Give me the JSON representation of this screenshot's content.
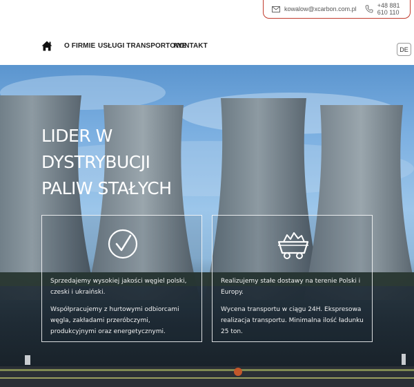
{
  "contact": {
    "email": "kowalow@xcarbon.com.pl",
    "phone": "+48 881 610 110"
  },
  "nav": {
    "items": [
      "O FIRMIE",
      "USŁUGI TRANSPORTOWE",
      "KONTAKT"
    ],
    "language": "DE"
  },
  "hero": {
    "title_lines": [
      "LIDER W",
      "DYSTRYBUCJI",
      "PALIW STAŁYCH"
    ]
  },
  "cards": [
    {
      "icon": "checkmark-circle-icon",
      "paragraphs": [
        "Sprzedajemy wysokiej jakości węgiel polski, czeski i ukraiński.",
        "Współpracujemy z hurtowymi odbiorcami węgla, zakładami przeróbczymi, produkcyjnymi oraz energetycznymi."
      ]
    },
    {
      "icon": "coal-cart-icon",
      "paragraphs": [
        "Realizujemy stałe dostawy na terenie Polski i Europy.",
        "Wycena transportu w ciągu 24H. Ekspresowa realizacja transportu. Minimalna ilość ładunku 25 ton."
      ]
    }
  ],
  "colors": {
    "accent": "#c0392b",
    "text_dark": "#222222",
    "hero_text": "#ffffff"
  }
}
